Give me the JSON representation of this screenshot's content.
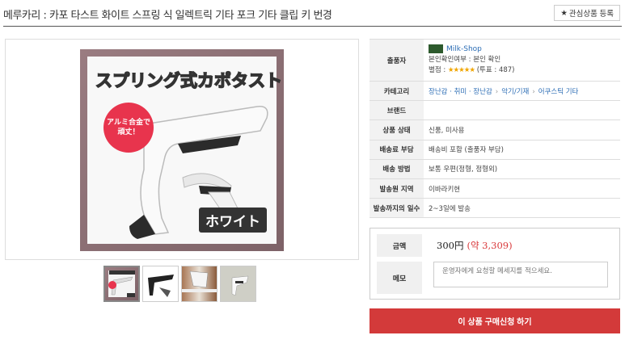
{
  "header": {
    "title": "메루카리 : 카포 타스트 화이트 스프링 식 일렉트릭 기타 포크 기타 클립 키 번경",
    "wish_button": "관심상품 등록",
    "wish_icon": "star-icon"
  },
  "gallery": {
    "main_title": "スプリング式カポタスト",
    "badge": "アルミ合金で頑丈！",
    "color_label": "ホワイト",
    "thumbnail_count": 4
  },
  "info": {
    "seller_label": "출품자",
    "seller_name": "Milk-Shop",
    "seller_verified": "본인확인여부 : 본인 확인",
    "seller_rating_prefix": "별점 : ",
    "seller_stars": "★★★★★",
    "seller_votes": " (투표 : 487)",
    "category_label": "카테고리",
    "category_path": [
      "장난감 · 취미 · 장난감",
      "악기/기재",
      "어쿠스틱 기타"
    ],
    "category_sep": "›",
    "brand_label": "브랜드",
    "brand_value": "",
    "condition_label": "상품 상태",
    "condition_value": "신품, 미사용",
    "shipping_fee_label": "배송료 부담",
    "shipping_fee_value": "배송비 포함 (출품자 부담)",
    "shipping_method_label": "배송 방법",
    "shipping_method_value": "보통 우편(정형, 정형외)",
    "origin_label": "발송원 지역",
    "origin_value": "이바라키현",
    "days_label": "발송까지의 일수",
    "days_value": "2~3일에 발송"
  },
  "purchase": {
    "price_label": "금액",
    "price_yen": "300円",
    "price_krw": "(약 3,309)",
    "memo_label": "메모",
    "memo_placeholder": "운영자에게 요청할 메세지를 적으세요.",
    "buy_button": "이 상품 구매신청 하기"
  },
  "colors": {
    "accent_red": "#d33a3a",
    "link_blue": "#2c6db5",
    "star": "#f0a500"
  }
}
